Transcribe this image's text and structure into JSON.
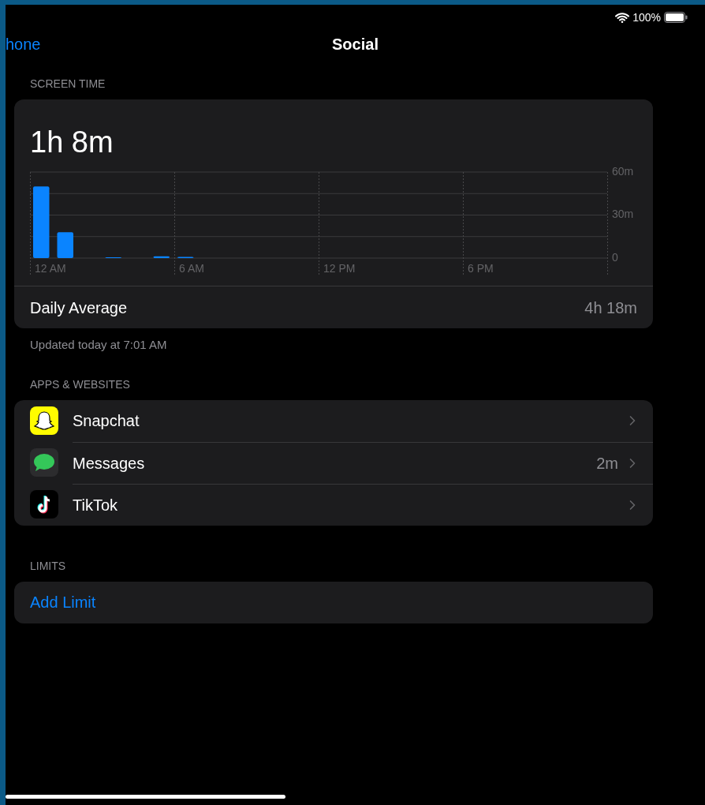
{
  "status_bar": {
    "battery": "100%"
  },
  "nav": {
    "back": "hone",
    "title": "Social"
  },
  "screen_time": {
    "header": "SCREEN TIME",
    "total": "1h 8m",
    "x_axis_labels": [
      "12 AM",
      "6 AM",
      "12 PM",
      "6 PM"
    ],
    "chart_data": {
      "type": "bar",
      "values": [
        50,
        18,
        0,
        0.6,
        0,
        1.3,
        0.8,
        0,
        0,
        0,
        0,
        0,
        0,
        0,
        0,
        0,
        0,
        0,
        0,
        0,
        0,
        0,
        0,
        0
      ],
      "ylim": [
        0,
        60
      ],
      "yticks": [
        {
          "value": 0,
          "label": "0"
        },
        {
          "value": 30,
          "label": "30m"
        },
        {
          "value": 60,
          "label": "60m"
        }
      ]
    },
    "average_label": "Daily Average",
    "average_value": "4h 18m",
    "updated": "Updated today at 7:01 AM"
  },
  "apps": {
    "header": "APPS & WEBSITES",
    "items": [
      {
        "kind": "snapchat",
        "name": "Snapchat"
      },
      {
        "kind": "messages",
        "name": "Messages",
        "time": "2m"
      },
      {
        "kind": "tiktok",
        "name": "TikTok"
      }
    ]
  },
  "limits": {
    "header": "LIMITS",
    "action": "Add Limit"
  }
}
